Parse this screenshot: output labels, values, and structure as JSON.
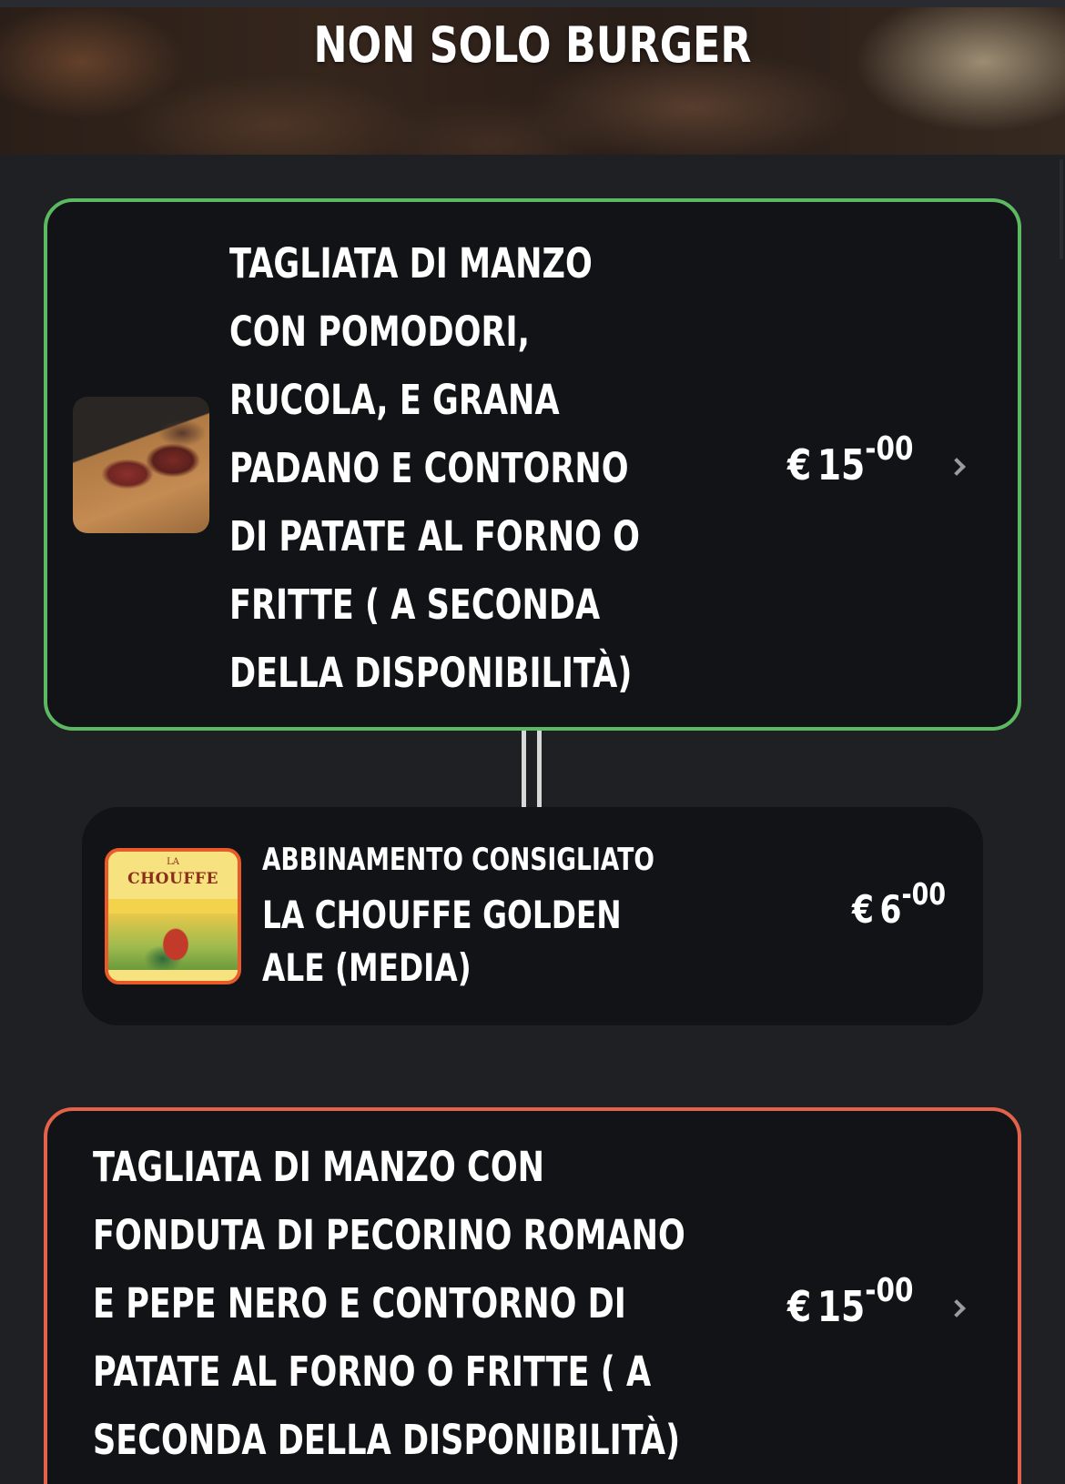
{
  "header": {
    "title": "NON SOLO BURGER"
  },
  "dishes": [
    {
      "title": "TAGLIATA DI MANZO CON POMODORI, RUCOLA, E GRANA PADANO E CONTORNO DI PATATE AL FORNO O FRITTE ( A SECONDA DELLA DISPONIBILITÀ)",
      "currency": "€",
      "price_whole": "15",
      "price_cents": "-00",
      "border_color": "#5cb962"
    },
    {
      "title": "TAGLIATA DI MANZO CON FONDUTA DI PECORINO ROMANO E PEPE NERO E CONTORNO DI PATATE AL FORNO O FRITTE ( A SECONDA DELLA DISPONIBILITÀ)",
      "currency": "€",
      "price_whole": "15",
      "price_cents": "-00",
      "border_color": "#e2624a"
    }
  ],
  "pairing": {
    "kicker": "ABBINAMENTO CONSIGLIATO",
    "title": "LA CHOUFFE GOLDEN ALE (MEDIA)",
    "currency": "€",
    "price_whole": "6",
    "price_cents": "-00",
    "image_text_small": "LA",
    "image_text_brand": "CHOUFFE"
  },
  "icons": {
    "chevron": "chevron-right-icon"
  }
}
